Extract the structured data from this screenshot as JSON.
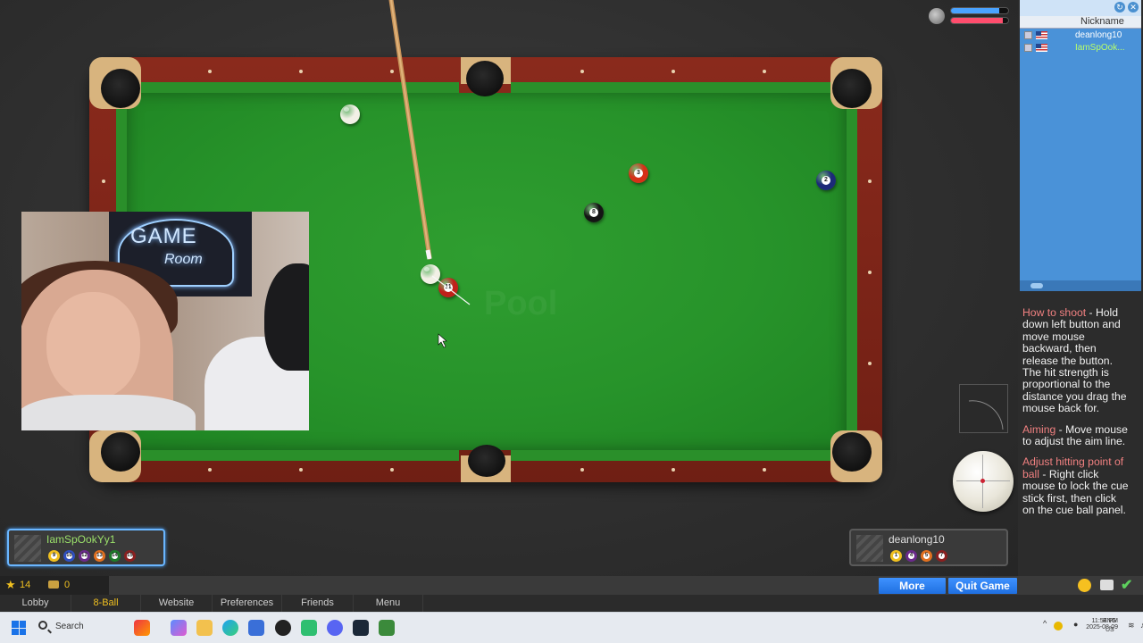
{
  "table": {
    "watermark": "Pool"
  },
  "balls": [
    {
      "id": "cue",
      "color": "#f2f0e6",
      "number": ""
    },
    {
      "id": "11",
      "color": "#c0201a",
      "number": "11"
    },
    {
      "id": "8",
      "color": "#151515",
      "number": "8"
    },
    {
      "id": "3",
      "color": "#d63018",
      "number": "3"
    },
    {
      "id": "2",
      "color": "#1c2a78",
      "number": "2"
    },
    {
      "id": "top-left",
      "color": "#f2f0e6",
      "number": ""
    }
  ],
  "players": {
    "left": {
      "name": "IamSpOokYy1",
      "name_color": "#9be06a",
      "balls": [
        "9",
        "10",
        "12",
        "13",
        "14",
        "15"
      ],
      "ball_colors": [
        "#f0c020",
        "#3050c0",
        "#6a2a8a",
        "#e07020",
        "#1f7a2a",
        "#8a2020"
      ]
    },
    "right": {
      "name": "deanlong10",
      "name_color": "#e0e0e0",
      "balls": [
        "1",
        "4",
        "5",
        "7"
      ],
      "ball_colors": [
        "#f0c020",
        "#6a2a8a",
        "#e07020",
        "#8a2020"
      ]
    }
  },
  "gauges": {
    "top_fill_color": "#4aa3ff",
    "bottom_fill_color": "#ff4d6d",
    "top_level": 0.85,
    "bottom_level": 0.9
  },
  "sidebar": {
    "header": "Nickname",
    "rows": [
      {
        "nickname": "deanlong10",
        "color": "#ffffff"
      },
      {
        "nickname": "IamSpOok...",
        "color": "#b8ff6a"
      }
    ],
    "help": [
      {
        "heading": "How to shoot",
        "text": " - Hold down left button and move mouse backward, then release the button. The hit strength is proportional to the distance you drag the mouse back for."
      },
      {
        "heading": "Aiming",
        "text": " - Move mouse to adjust the aim line."
      },
      {
        "heading": "Adjust hitting point of ball",
        "text": " - Right click mouse to lock the cue stick first, then click on the cue ball panel."
      }
    ]
  },
  "stats": {
    "stars": "14",
    "coins": "0"
  },
  "buttons": {
    "more": "More",
    "quit": "Quit Game"
  },
  "nav": [
    "Lobby",
    "8-Ball",
    "Website",
    "Preferences",
    "Friends",
    "Menu"
  ],
  "webcam": {
    "sign_line1": "GAME",
    "sign_line2": "Room"
  },
  "taskbar": {
    "search_placeholder": "Search",
    "lang_top": "ENG",
    "lang_bottom": "US",
    "time": "11:54 PM",
    "date": "2025-08-09"
  }
}
